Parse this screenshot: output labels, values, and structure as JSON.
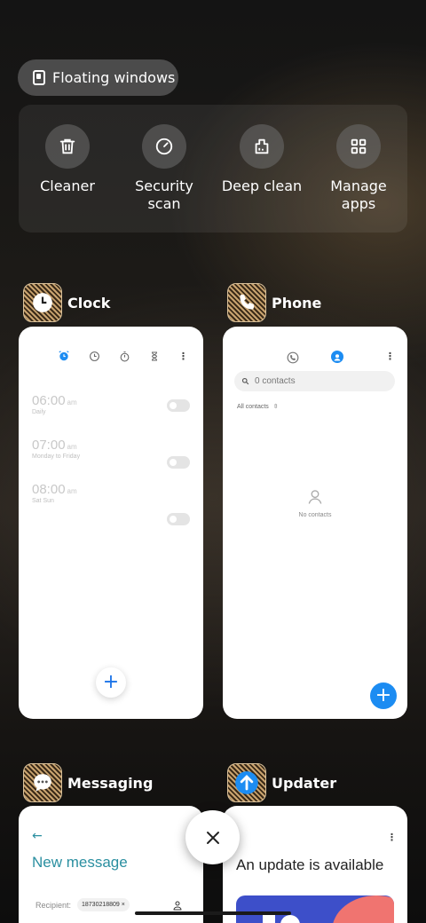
{
  "floating_windows": {
    "label": "Floating windows"
  },
  "quick_actions": [
    {
      "label": "Cleaner",
      "icon": "trash-icon"
    },
    {
      "label": "Security\nscan",
      "icon": "security-scan-icon"
    },
    {
      "label": "Deep clean",
      "icon": "deep-clean-icon"
    },
    {
      "label": "Manage\napps",
      "icon": "grid-apps-icon"
    }
  ],
  "apps": {
    "clock": {
      "title": "Clock",
      "alarms": [
        {
          "time": "06:00",
          "ampm": "am",
          "repeat": "Daily"
        },
        {
          "time": "07:00",
          "ampm": "am",
          "repeat": "Monday to Friday"
        },
        {
          "time": "08:00",
          "ampm": "am",
          "repeat": "Sat Sun"
        }
      ],
      "fab": "+"
    },
    "phone": {
      "title": "Phone",
      "search_placeholder": "0 contacts",
      "filter": "All contacts",
      "empty": "No contacts",
      "fab": "+"
    },
    "messaging": {
      "title": "Messaging",
      "heading": "New message",
      "recipient_label": "Recipient:",
      "recipient_chip": "18730218809 ×"
    },
    "updater": {
      "title": "Updater",
      "heading": "An update is available"
    }
  },
  "close": {
    "label": "×"
  },
  "colors": {
    "accent": "#1c8cf2",
    "teal": "#2a8fa0"
  }
}
